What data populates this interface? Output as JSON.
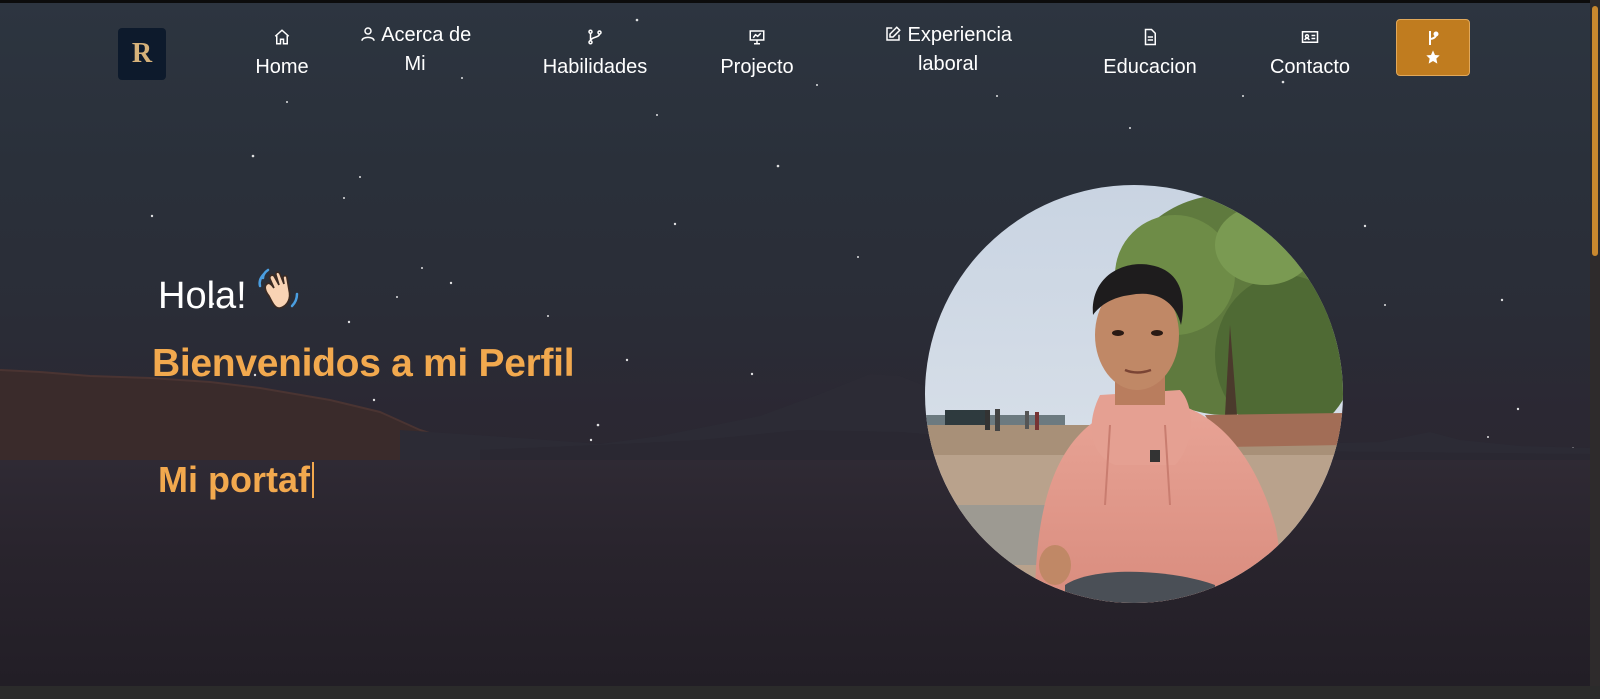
{
  "nav": {
    "logo_text": "R",
    "items": [
      {
        "label_line1": "Acerca de",
        "label_line2": "Mi",
        "icon": "user-icon"
      },
      {
        "label": "Home",
        "icon": "home-icon"
      },
      {
        "label": "Habilidades",
        "icon": "git-branch-icon"
      },
      {
        "label": "Projecto",
        "icon": "presentation-icon"
      },
      {
        "label_line1": "Experiencia",
        "label_line2": "laboral",
        "icon": "edit-icon"
      },
      {
        "label": "Educacion",
        "icon": "document-icon"
      },
      {
        "label": "Contacto",
        "icon": "contact-card-icon"
      }
    ],
    "fork_button": {
      "icons": [
        "git-fork-icon",
        "star-icon"
      ]
    }
  },
  "hero": {
    "greeting": "Hola!",
    "greeting_emoji": "waving-hand-icon",
    "welcome": "Bienvenidos a mi Perfil",
    "typed_text": "Mi portaf"
  },
  "avatar": {
    "icon": "profile-photo"
  },
  "colors": {
    "accent": "#f2a94e",
    "button": "#c07c1f",
    "logo_bg": "#0d1a2c",
    "scroll_thumb": "#c9882e"
  }
}
